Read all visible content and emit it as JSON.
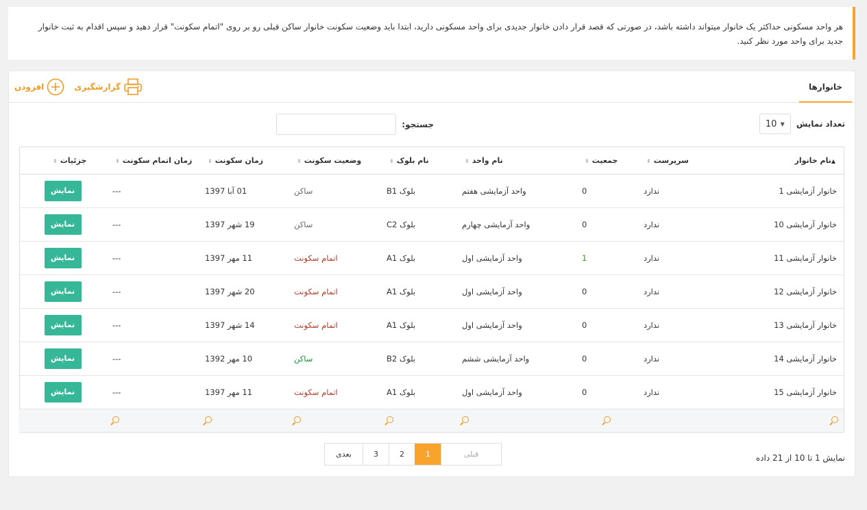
{
  "notice": {
    "text": "هر واحد مسکونی حداکثر یک خانوار میتواند داشته باشد، در صورتی که قصد قرار دادن خانوار جدیدی برای واحد مسکونی دارید، ابتدا باید وضعیت سکونت خانوار ساکن قبلی رو بر روی \"اتمام سکونت\" قرار دهید و سپس اقدام به ثبت خانوار جدید برای واحد مورد نظر کنید."
  },
  "panel": {
    "title": "خانوارها",
    "report_label": "گزارشگیری",
    "add_label": "افزودن"
  },
  "controls": {
    "length_label": "تعداد نمایش",
    "length_value": "10",
    "search_label": "جستجو:",
    "search_value": ""
  },
  "table": {
    "headers": {
      "name": "نام خانوار",
      "parent": "سرپرست",
      "population": "جمعیت",
      "unit": "نام واحد",
      "block": "نام بلوک",
      "status": "وضعیت سکونت",
      "start": "زمان سکونت",
      "end": "زمان اتمام سکونت",
      "details": "جزئیات"
    },
    "rows": [
      {
        "name": "خانوار آزمایشی 1",
        "parent": "ندارد",
        "population": "0",
        "unit": "واحد آزمایشی هفتم",
        "block": "بلوک B1",
        "status": "ساکن",
        "start": "01 آبا 1397",
        "end": "---",
        "btn": "نمایش"
      },
      {
        "name": "خانوار آزمایشی 10",
        "parent": "ندارد",
        "population": "0",
        "unit": "واحد آزمایشی چهارم",
        "block": "بلوک C2",
        "status": "ساکن",
        "start": "19 شهر 1397",
        "end": "---",
        "btn": "نمایش"
      },
      {
        "name": "خانوار آزمایشی 11",
        "parent": "ندارد",
        "population": "1",
        "unit": "واحد آزمایشی اول",
        "block": "بلوک A1",
        "status": "اتمام سکونت",
        "start": "11 مهر 1397",
        "end": "---",
        "btn": "نمایش"
      },
      {
        "name": "خانوار آزمایشی 12",
        "parent": "ندارد",
        "population": "0",
        "unit": "واحد آزمایشی اول",
        "block": "بلوک A1",
        "status": "اتمام سکونت",
        "start": "20 شهر 1397",
        "end": "---",
        "btn": "نمایش"
      },
      {
        "name": "خانوار آزمایشی 13",
        "parent": "ندارد",
        "population": "0",
        "unit": "واحد آزمایشی اول",
        "block": "بلوک A1",
        "status": "اتمام سکونت",
        "start": "14 شهر 1397",
        "end": "---",
        "btn": "نمایش"
      },
      {
        "name": "خانوار آزمایشی 14",
        "parent": "ندارد",
        "population": "0",
        "unit": "واحد آزمایشی ششم",
        "block": "بلوک B2",
        "status": "ساکن",
        "start": "10 مهر 1392",
        "end": "---",
        "btn": "نمایش"
      },
      {
        "name": "خانوار آزمایشی 15",
        "parent": "ندارد",
        "population": "0",
        "unit": "واحد آزمایشی اول",
        "block": "بلوک A1",
        "status": "اتمام سکونت",
        "start": "11 مهر 1397",
        "end": "---",
        "btn": "نمایش"
      }
    ]
  },
  "footer": {
    "info": "نمایش 1 تا 10 از 21 داده",
    "prev": "قبلی",
    "pages": [
      "1",
      "2",
      "3"
    ],
    "next": "بعدی"
  },
  "colors": {
    "accent": "#f7a32c",
    "button": "#36b898",
    "status_live": "#1b8a3c",
    "status_end": "#b13a2a"
  }
}
